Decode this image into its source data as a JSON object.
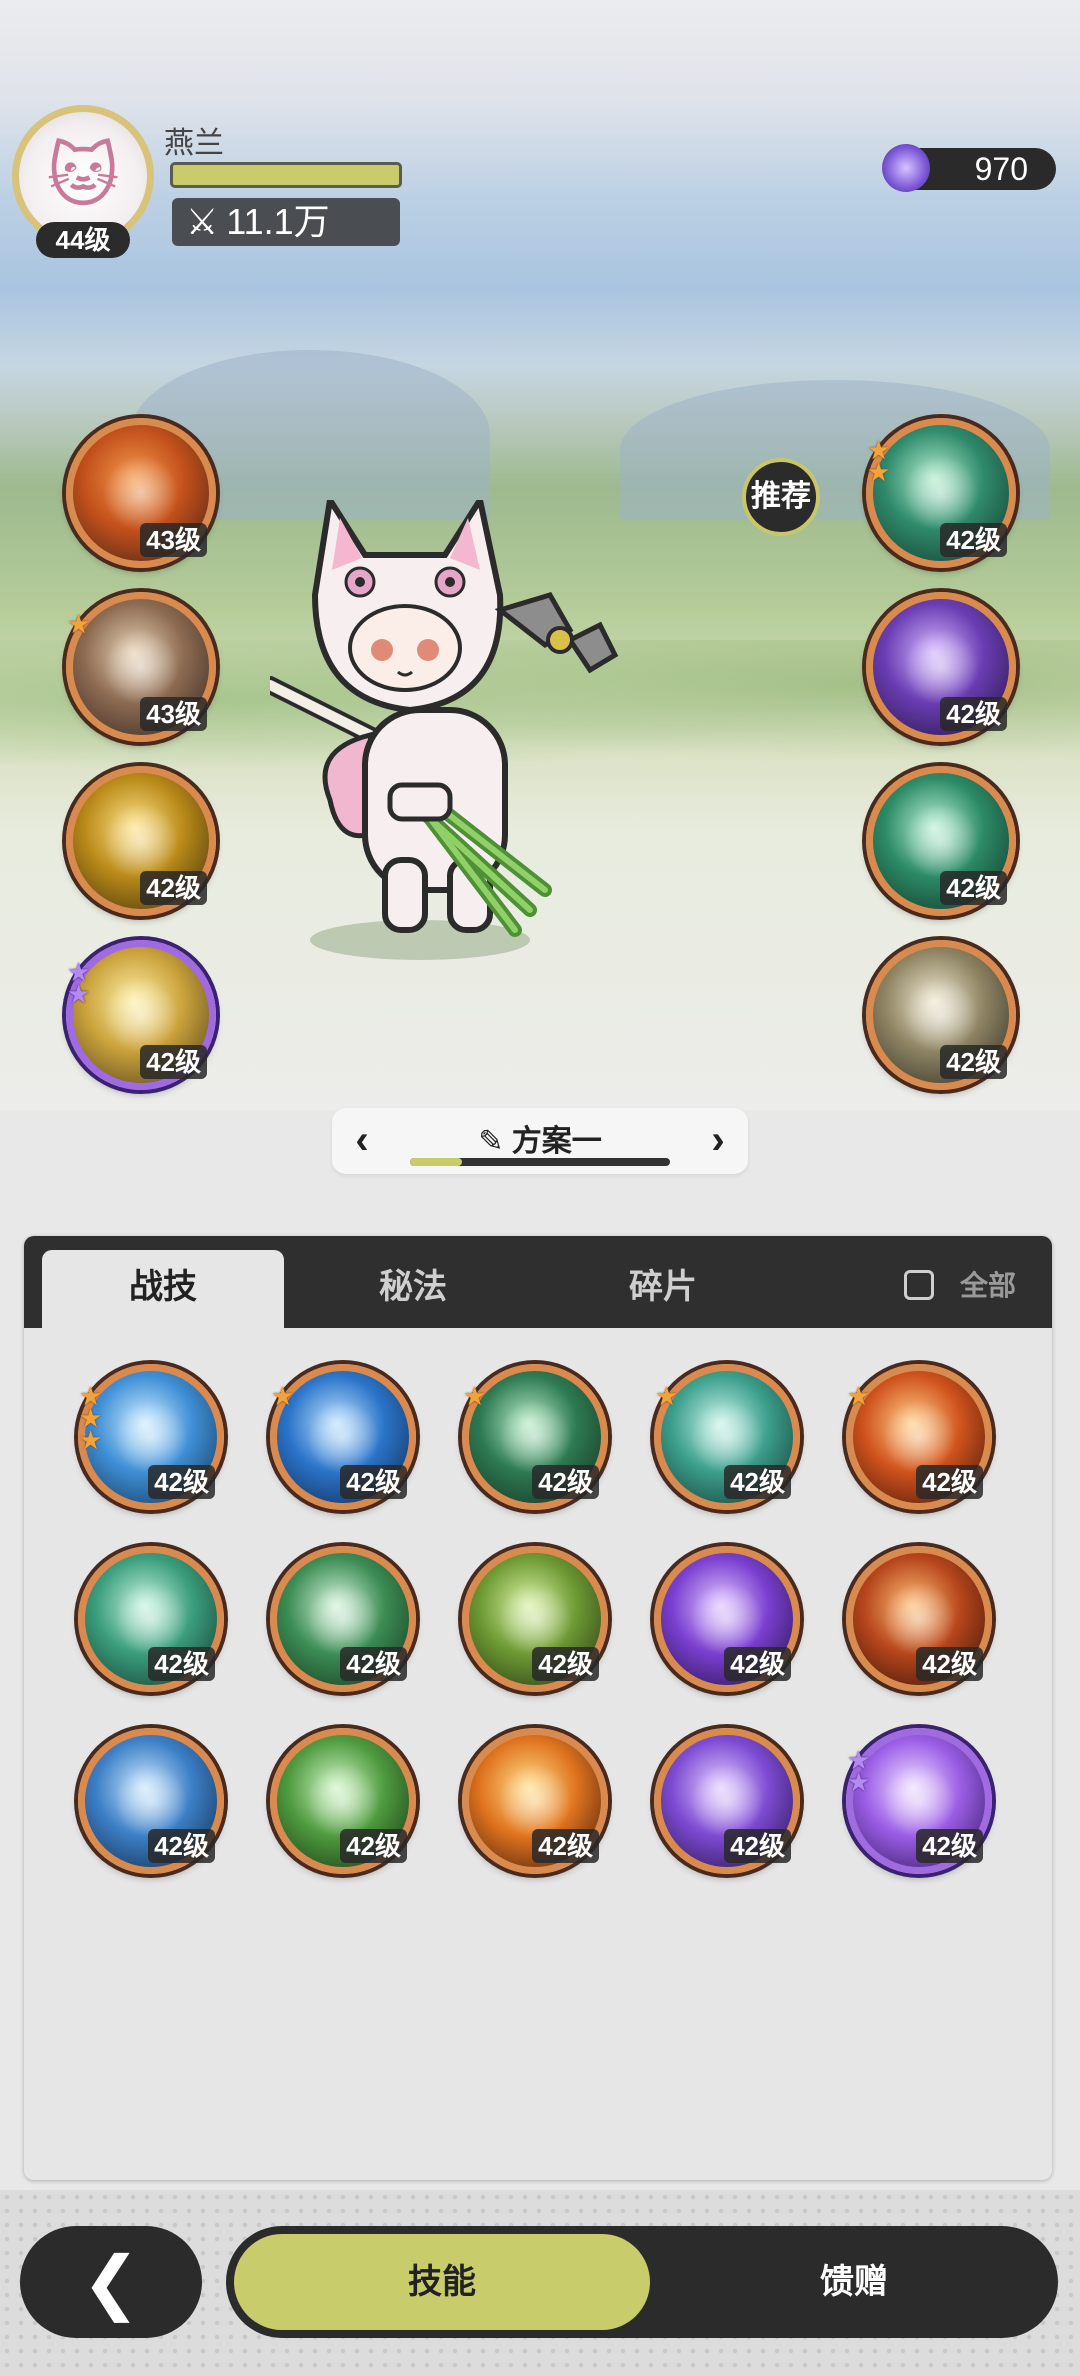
{
  "player": {
    "name": "燕兰",
    "level": "44级",
    "power": "11.1万",
    "hp_fraction": 1.0
  },
  "currency": {
    "icon": "gem-icon",
    "amount": "970"
  },
  "recommend_label": "推荐",
  "left_slots": [
    {
      "icon": "wolf-fire-icon",
      "level": "43级",
      "stars": 0,
      "rarity": "orange",
      "colors": [
        "#f39a4d",
        "#c4511c",
        "#3e1f14"
      ]
    },
    {
      "icon": "cards-icon",
      "level": "43级",
      "stars": 1,
      "rarity": "orange",
      "colors": [
        "#e7d3b5",
        "#8d6b52",
        "#2f231c"
      ]
    },
    {
      "icon": "crystal-icon",
      "level": "42级",
      "stars": 0,
      "rarity": "orange",
      "colors": [
        "#ffe38a",
        "#b98a19",
        "#3a2a0b"
      ]
    },
    {
      "icon": "sparkle-icon",
      "level": "42级",
      "stars": 2,
      "rarity": "purple",
      "colors": [
        "#fff0a6",
        "#caa23b",
        "#4a3a1a"
      ]
    }
  ],
  "right_slots": [
    {
      "icon": "shield-icon",
      "level": "42级",
      "stars": 2,
      "rarity": "orange",
      "colors": [
        "#b6efd0",
        "#2f8a6c",
        "#123428"
      ]
    },
    {
      "icon": "fist-icon",
      "level": "42级",
      "stars": 0,
      "rarity": "orange",
      "colors": [
        "#d6b9ff",
        "#6a3db3",
        "#1f1238"
      ]
    },
    {
      "icon": "heart-icon",
      "level": "42级",
      "stars": 0,
      "rarity": "orange",
      "colors": [
        "#bdf3d8",
        "#2c8a66",
        "#0f2f24"
      ]
    },
    {
      "icon": "ring-icon",
      "level": "42级",
      "stars": 0,
      "rarity": "orange",
      "colors": [
        "#f0e9d2",
        "#8f8564",
        "#2a281e"
      ]
    }
  ],
  "plan": {
    "name": "方案一",
    "progress": 0.2
  },
  "tabs": [
    {
      "label": "战技",
      "active": true
    },
    {
      "label": "秘法",
      "active": false
    },
    {
      "label": "碎片",
      "active": false
    }
  ],
  "show_all_label": "全部",
  "skills": [
    {
      "icon": "ice-splash-icon",
      "level": "42级",
      "stars": 3,
      "rarity": "orange",
      "colors": [
        "#cdeeff",
        "#3f8fd6",
        "#12304f"
      ]
    },
    {
      "icon": "water-wave-icon",
      "level": "42级",
      "stars": 1,
      "rarity": "orange",
      "colors": [
        "#bfe4ff",
        "#2b74c9",
        "#0e2447"
      ]
    },
    {
      "icon": "thorn-vine-icon",
      "level": "42级",
      "stars": 1,
      "rarity": "orange",
      "colors": [
        "#b9eec8",
        "#2e7a52",
        "#0f2b1e"
      ]
    },
    {
      "icon": "whirlpool-icon",
      "level": "42级",
      "stars": 1,
      "rarity": "orange",
      "colors": [
        "#c8f4ea",
        "#3c9f8c",
        "#10332d"
      ]
    },
    {
      "icon": "flame-icon",
      "level": "42级",
      "stars": 1,
      "rarity": "orange",
      "colors": [
        "#ffd08a",
        "#d0531d",
        "#3a1208"
      ]
    },
    {
      "icon": "wind-slash-icon",
      "level": "42级",
      "stars": 0,
      "rarity": "orange",
      "colors": [
        "#c9f5e2",
        "#3b9e7d",
        "#11332a"
      ]
    },
    {
      "icon": "heal-cross-icon",
      "level": "42级",
      "stars": 0,
      "rarity": "orange",
      "colors": [
        "#d6f5dd",
        "#3d8d55",
        "#10301b"
      ]
    },
    {
      "icon": "scroll-icon",
      "level": "42级",
      "stars": 0,
      "rarity": "orange",
      "colors": [
        "#dbf3a8",
        "#6e9a34",
        "#20300f"
      ]
    },
    {
      "icon": "eye-icon",
      "level": "42级",
      "stars": 0,
      "rarity": "orange",
      "colors": [
        "#e2c8ff",
        "#7a3fd0",
        "#1e0f3b"
      ]
    },
    {
      "icon": "fire-swirl-icon",
      "level": "42级",
      "stars": 0,
      "rarity": "orange",
      "colors": [
        "#ffc078",
        "#b7461c",
        "#2f0f06"
      ]
    },
    {
      "icon": "ice-shard-icon",
      "level": "42级",
      "stars": 0,
      "rarity": "orange",
      "colors": [
        "#cde9ff",
        "#3c7fc6",
        "#0f2542"
      ]
    },
    {
      "icon": "green-slash-icon",
      "level": "42级",
      "stars": 0,
      "rarity": "orange",
      "colors": [
        "#d2f6c7",
        "#4f9b3f",
        "#132d10"
      ]
    },
    {
      "icon": "fire-orb-icon",
      "level": "42级",
      "stars": 0,
      "rarity": "orange",
      "colors": [
        "#ffe08a",
        "#e0741f",
        "#3b1608"
      ]
    },
    {
      "icon": "purple-vortex-icon",
      "level": "42级",
      "stars": 0,
      "rarity": "orange",
      "colors": [
        "#e5cfff",
        "#7d4bd3",
        "#1f1040"
      ]
    },
    {
      "icon": "star-portal-icon",
      "level": "42级",
      "stars": 2,
      "rarity": "purple",
      "colors": [
        "#f1e0ff",
        "#9b5ee6",
        "#2b1456"
      ]
    }
  ],
  "footer": {
    "back_icon": "chevron-left-icon",
    "skill_label": "技能",
    "gift_label": "馈赠"
  }
}
